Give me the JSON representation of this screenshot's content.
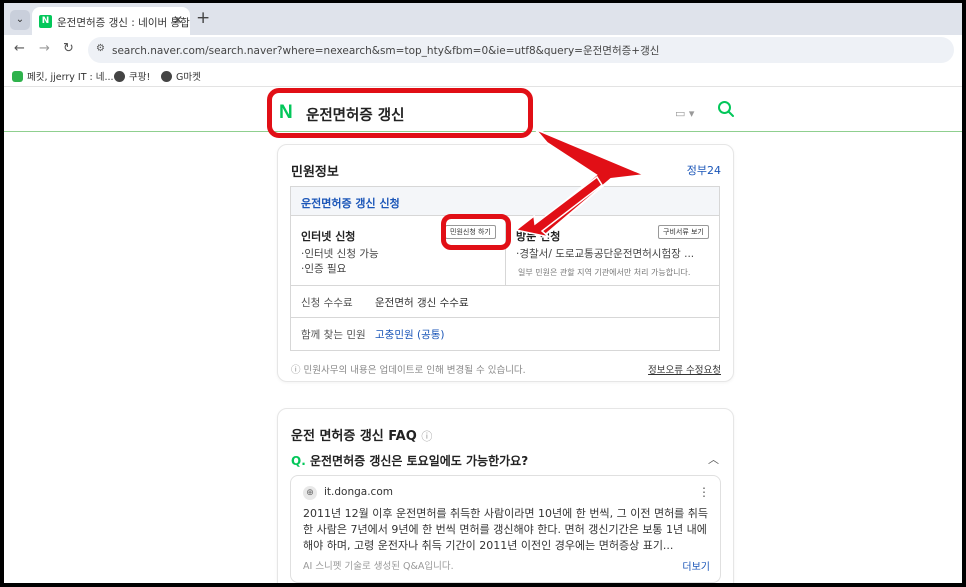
{
  "browser": {
    "tab_title": "운전면허증 갱신 : 네이버 통합",
    "tab_favicon_letter": "N",
    "url": "search.naver.com/search.naver?where=nexearch&sm=top_hty&fbm=0&ie=utf8&query=운전면허증+갱신",
    "bookmarks": [
      "페킷, jjerry IT : 네...",
      "쿠팡!",
      "G마켓"
    ]
  },
  "search": {
    "logo": "N",
    "query": "운전면허증 갱신"
  },
  "civil": {
    "title": "민원정보",
    "source": "정부24",
    "service_title": "운전면허증 갱신 신청",
    "internet": {
      "name": "인터넷 신청",
      "button": "민원신청 하기",
      "lines": [
        "인터넷 신청 가능",
        "인증 필요"
      ]
    },
    "visit": {
      "name": "방문 신청",
      "button": "구비서류 보기",
      "line": "경찰서/ 도로교통공단운전면허시험장 ...",
      "note": "일부 민원은 관할 지역 기관에서만 처리 가능합니다."
    },
    "fee": {
      "label": "신청 수수료",
      "value": "운전면허 갱신 수수료"
    },
    "related": {
      "label": "함께 찾는 민원",
      "value": "고충민원 (공통)"
    },
    "footnote": "민원사무의 내용은 업데이트로 인해 변경될 수 있습니다.",
    "report_link": "정보오류 수정요청"
  },
  "faq": {
    "title": "운전 면허증 갱신 FAQ",
    "question_mark": "Q.",
    "question": "운전면허증 갱신은 토요일에도 가능한가요?",
    "answer_domain": "it.donga.com",
    "answer_text": "2011년 12월 이후 운전면허를 취득한 사람이라면 10년에 한 번씩, 그 이전 면허를 취득한 사람은 7년에서 9년에 한 번씩 면허를 갱신해야 한다. 면허 갱신기간은 보통 1년 내에 해야 하며, 고령 운전자나 취득 기간이 2011년 이전인 경우에는 면허증상 표기...",
    "answer_foot": "AI 스니펫 기술로 생성된 Q&A입니다.",
    "answer_more": "더보기"
  },
  "colors": {
    "naver_green": "#03c75a",
    "link_blue": "#1b56b8",
    "annotation_red": "#e10f16"
  }
}
